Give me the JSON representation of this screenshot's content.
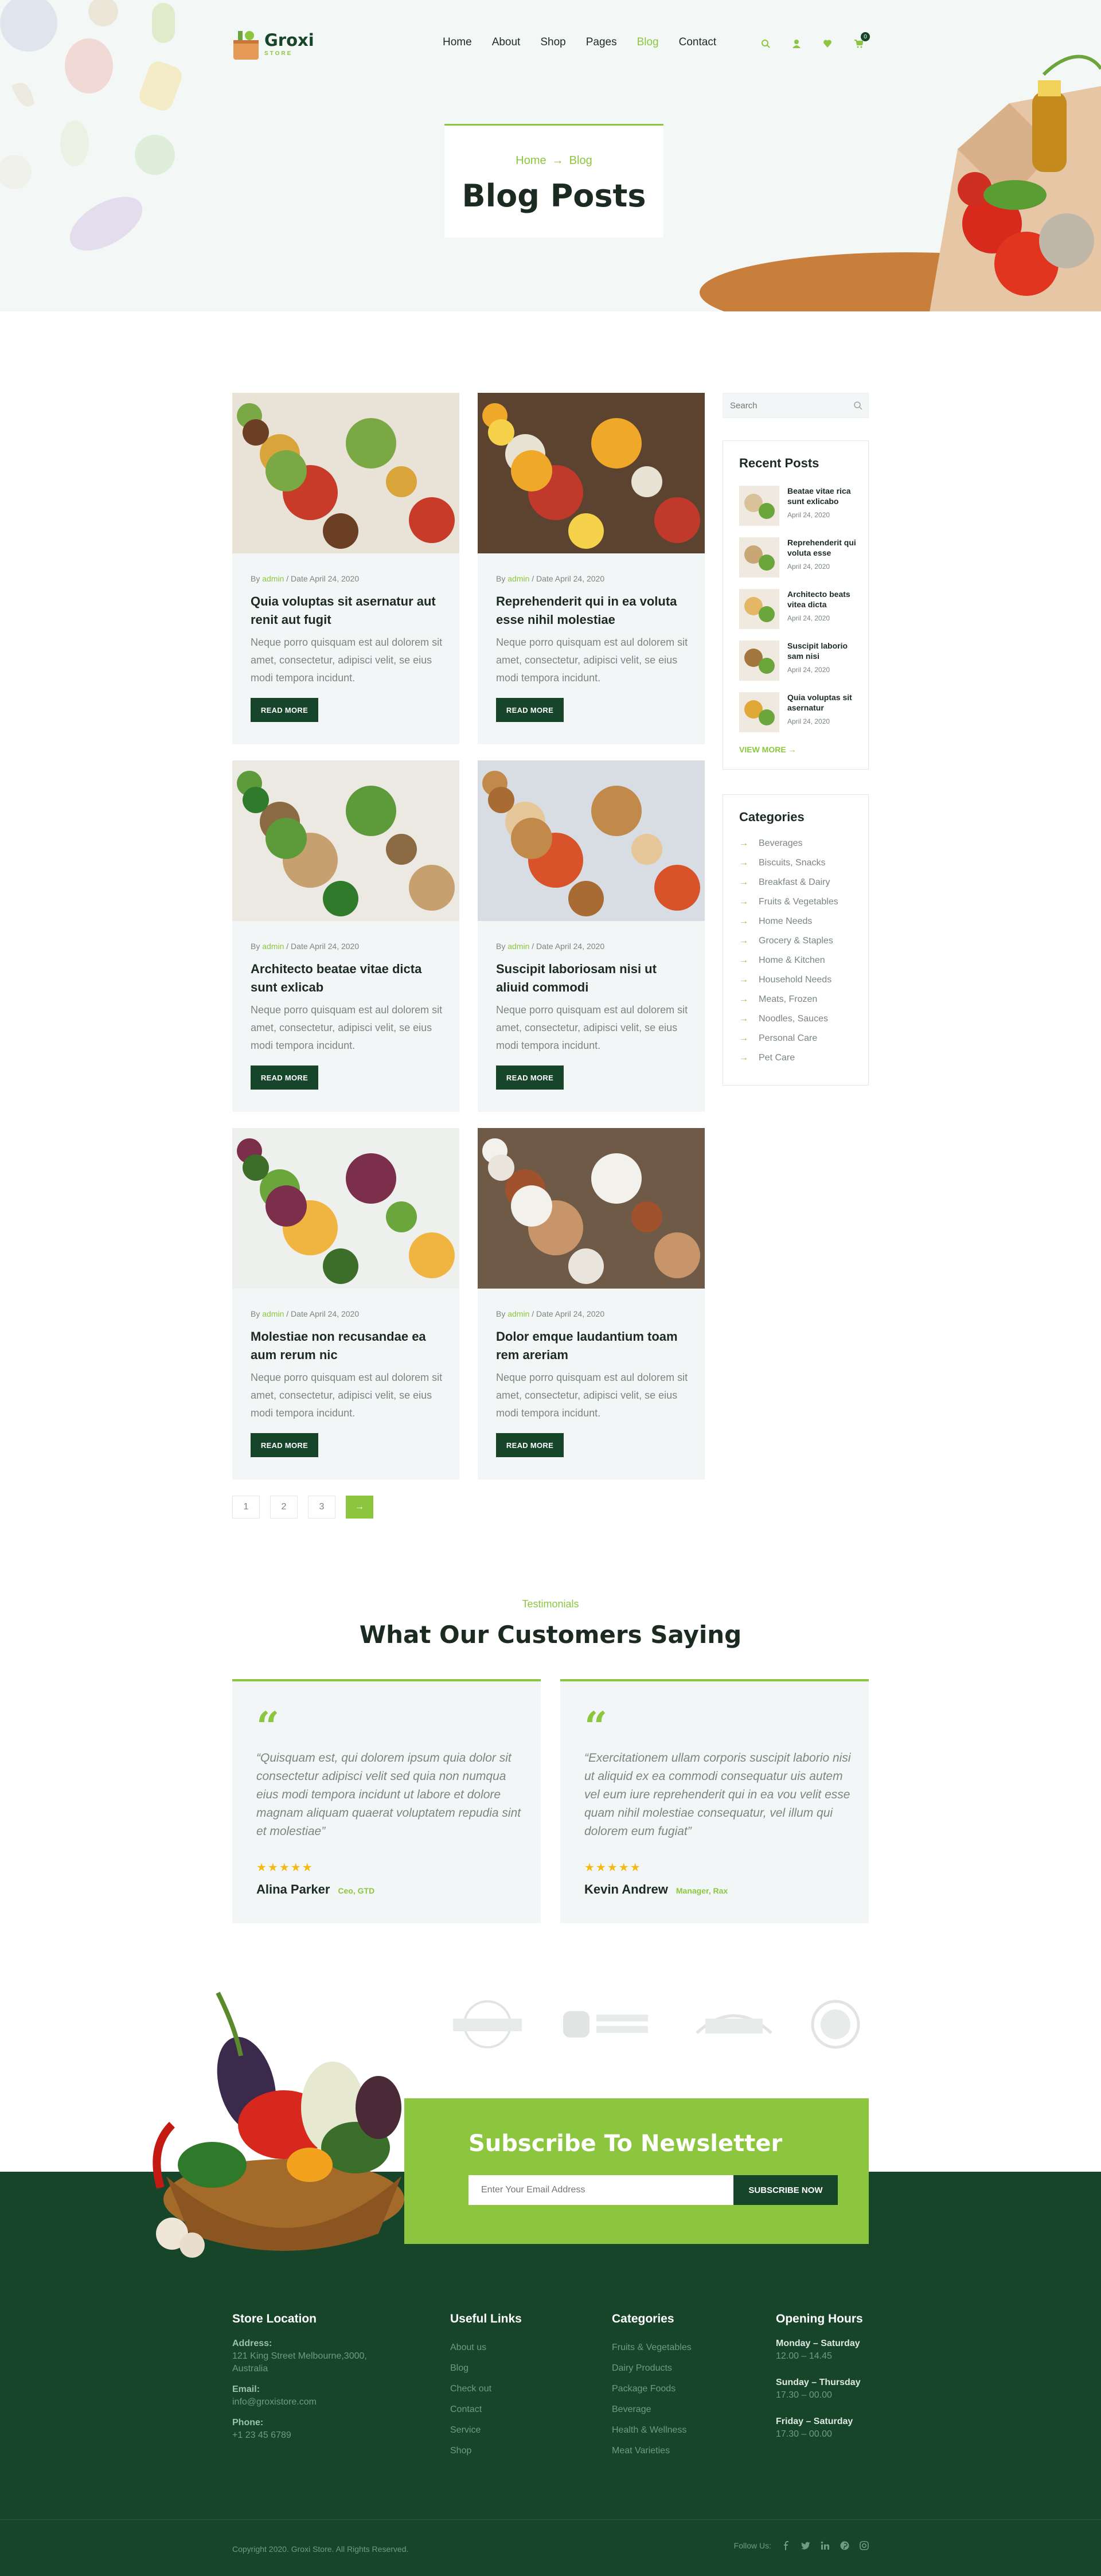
{
  "brand": {
    "name": "Groxi",
    "sub": "STORE"
  },
  "nav": [
    "Home",
    "About",
    "Shop",
    "Pages",
    "Blog",
    "Contact"
  ],
  "cart_count": "0",
  "hero": {
    "crumb_home": "Home",
    "crumb_current": "Blog",
    "title": "Blog Posts"
  },
  "posts": [
    {
      "meta_by": "By ",
      "author": "admin",
      "date": " / Date April 24, 2020",
      "title": "Quia voluptas sit asernatur aut renit aut fugit",
      "excerpt": "Neque porro quisquam est aul dolorem sit amet, consectetur, adipisci velit, se eius modi tempora incidunt.",
      "btn": "READ MORE"
    },
    {
      "meta_by": "By ",
      "author": "admin",
      "date": " / Date April 24, 2020",
      "title": "Reprehenderit qui in ea voluta esse nihil molestiae",
      "excerpt": "Neque porro quisquam est aul dolorem sit amet, consectetur, adipisci velit, se eius modi tempora incidunt.",
      "btn": "READ MORE"
    },
    {
      "meta_by": "By ",
      "author": "admin",
      "date": " / Date April 24, 2020",
      "title": "Architecto beatae vitae dicta sunt exlicab",
      "excerpt": "Neque porro quisquam est aul dolorem sit amet, consectetur, adipisci velit, se eius modi tempora incidunt.",
      "btn": "READ MORE"
    },
    {
      "meta_by": "By ",
      "author": "admin",
      "date": " / Date April 24, 2020",
      "title": "Suscipit laboriosam nisi ut aliuid commodi",
      "excerpt": "Neque porro quisquam est aul dolorem sit amet, consectetur, adipisci velit, se eius modi tempora incidunt.",
      "btn": "READ MORE"
    },
    {
      "meta_by": "By ",
      "author": "admin",
      "date": " / Date April 24, 2020",
      "title": "Molestiae non recusandae ea aum rerum nic",
      "excerpt": "Neque porro quisquam est aul dolorem sit amet, consectetur, adipisci velit, se eius modi tempora incidunt.",
      "btn": "READ MORE"
    },
    {
      "meta_by": "By ",
      "author": "admin",
      "date": " / Date April 24, 2020",
      "title": "Dolor emque laudantium toam rem areriam",
      "excerpt": "Neque porro quisquam est aul dolorem sit amet, consectetur, adipisci velit, se eius modi tempora incidunt.",
      "btn": "READ MORE"
    }
  ],
  "pagination": [
    "1",
    "2",
    "3"
  ],
  "sidebar": {
    "search_placeholder": "Search",
    "recent_title": "Recent Posts",
    "recent": [
      {
        "title": "Beatae vitae rica sunt exlicabo",
        "date": "April 24, 2020"
      },
      {
        "title": "Reprehenderit qui voluta esse",
        "date": "April 24, 2020"
      },
      {
        "title": "Architecto beats vitea dicta",
        "date": "April 24, 2020"
      },
      {
        "title": "Suscipit laborio sam nisi",
        "date": "April 24, 2020"
      },
      {
        "title": "Quia voluptas sit asernatur",
        "date": "April 24, 2020"
      }
    ],
    "view_more": "VIEW MORE",
    "categories_title": "Categories",
    "categories": [
      "Beverages",
      "Biscuits, Snacks",
      "Breakfast & Dairy",
      "Fruits & Vegetables",
      "Home Needs",
      "Grocery & Staples",
      "Home & Kitchen",
      "Household Needs",
      "Meats, Frozen",
      "Noodles, Sauces",
      "Personal Care",
      "Pet Care"
    ]
  },
  "testimonials": {
    "eyebrow": "Testimonials",
    "title": "What Our Customers Saying",
    "items": [
      {
        "quote": "“Quisquam est, qui dolorem ipsum quia dolor sit consectetur adipisci velit sed quia non numqua eius modi tempora incidunt ut labore et dolore magnam aliquam quaerat voluptatem repudia sint et molestiae”",
        "stars": "★★★★★",
        "name": "Alina Parker",
        "role": "Ceo, GTD"
      },
      {
        "quote": "“Exercitationem ullam corporis suscipit laborio nisi ut aliquid ex ea commodi consequatur uis autem vel eum iure reprehenderit qui in ea vou velit esse quam nihil molestiae consequatur, vel illum qui dolorem eum fugiat”",
        "stars": "★★★★★",
        "name": "Kevin Andrew",
        "role": "Manager, Rax"
      }
    ]
  },
  "newsletter": {
    "title": "Subscribe To Newsletter",
    "placeholder": "Enter Your Email Address",
    "button": "SUBSCRIBE NOW"
  },
  "footer": {
    "store": {
      "title": "Store Location",
      "address_label": "Address:",
      "address": "121 King Street Melbourne,3000, Australia",
      "email_label": "Email:",
      "email": "info@groxistore.com",
      "phone_label": "Phone:",
      "phone": "+1 23 45 6789"
    },
    "useful": {
      "title": "Useful Links",
      "links": [
        "About us",
        "Blog",
        "Check out",
        "Contact",
        "Service",
        "Shop"
      ]
    },
    "categories": {
      "title": "Categories",
      "links": [
        "Fruits & Vegetables",
        "Dairy Products",
        "Package Foods",
        "Beverage",
        "Health & Wellness",
        "Meat Varieties"
      ]
    },
    "hours": {
      "title": "Opening Hours",
      "rows": [
        {
          "day": "Monday – Saturday",
          "time": "12.00 – 14.45"
        },
        {
          "day": "Sunday – Thursday",
          "time": "17.30 – 00.00"
        },
        {
          "day": "Friday – Saturday",
          "time": "17.30 – 00.00"
        }
      ]
    },
    "copyright": "Copyright 2020. Groxi Store. All Rights Reserved.",
    "follow": "Follow Us:"
  }
}
